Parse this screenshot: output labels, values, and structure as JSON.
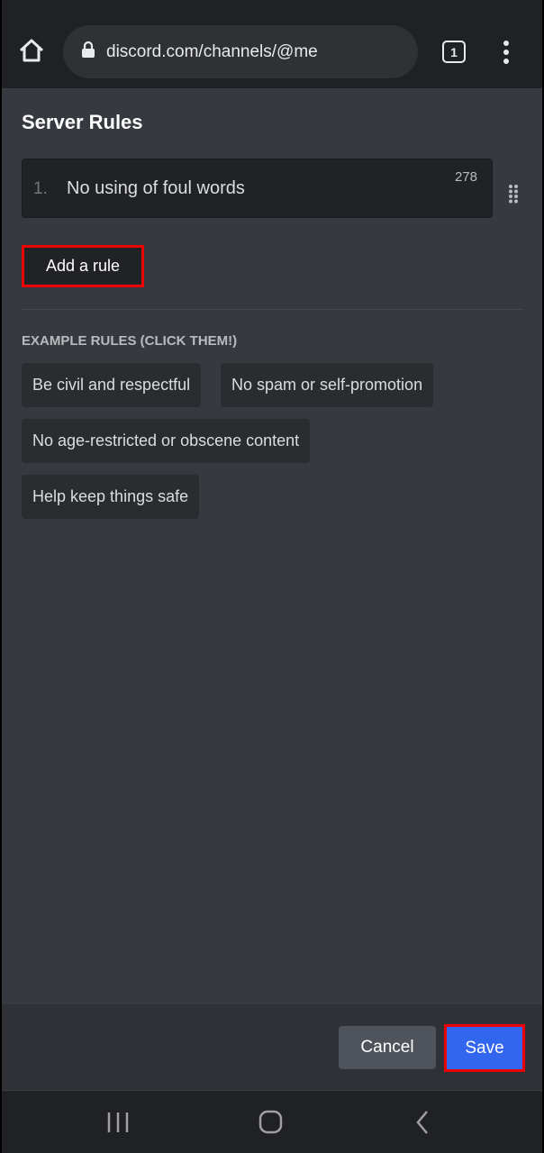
{
  "browser": {
    "url": "discord.com/channels/@me",
    "tab_count": "1"
  },
  "page": {
    "title": "Server Rules",
    "rules": [
      {
        "number": "1.",
        "text": "No using of foul words",
        "remaining": "278"
      }
    ],
    "add_rule_label": "Add a rule",
    "examples_label": "EXAMPLE RULES (CLICK THEM!)",
    "examples": [
      "Be civil and respectful",
      "No spam or self-promotion",
      "No age-restricted or obscene content",
      "Help keep things safe"
    ]
  },
  "footer": {
    "cancel_label": "Cancel",
    "save_label": "Save"
  },
  "colors": {
    "accent": "#3366ee",
    "highlight": "#ee0000",
    "background": "#36393f"
  }
}
